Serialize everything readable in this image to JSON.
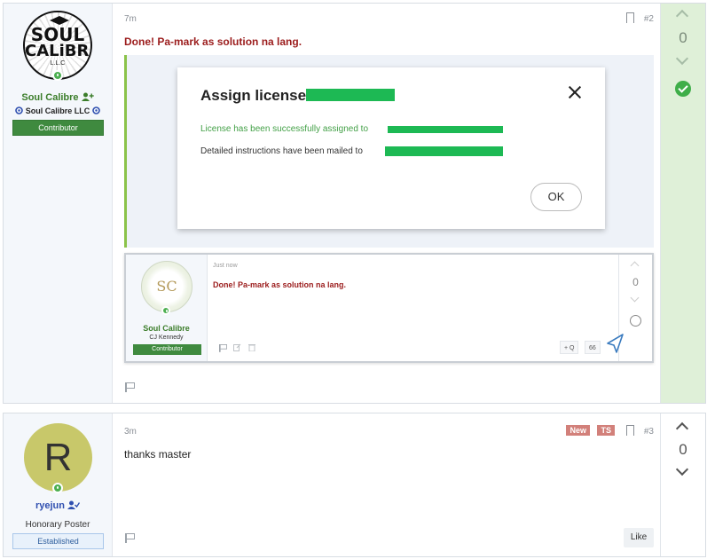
{
  "posts": [
    {
      "username": "Soul Calibre",
      "user_title": "Soul Calibre LLC",
      "banner": "Contributor",
      "time": "7m",
      "number": "#2",
      "message": "Done! Pa-mark as solution na lang.",
      "votes": "0",
      "solution": true,
      "avatar_text": {
        "line1": "SOUL",
        "line2": "CALiBRE",
        "line3": "L.L.C"
      },
      "screenshot_dialog": {
        "title": "Assign license:",
        "line1": "License has been successfully assigned to",
        "line2": "Detailed instructions have been mailed to",
        "ok": "OK"
      },
      "embedded_post": {
        "time": "Just now",
        "message": "Done! Pa-mark as solution na lang.",
        "username": "Soul Calibre",
        "user_sub": "CJ Kennedy",
        "banner": "Contributor",
        "votes": "0",
        "avatar_monogram": "SC",
        "quote_btn": "+ Q",
        "reply_btn": "66"
      }
    },
    {
      "username": "ryejun",
      "user_title": "Honorary Poster",
      "banner": "Established",
      "avatar_letter": "R",
      "time": "3m",
      "number": "#3",
      "badge_new": "New",
      "badge_ts": "TS",
      "message": "thanks master",
      "votes": "0",
      "like": "Like"
    }
  ],
  "colors": {
    "username_green": "#3b7d2a",
    "username_blue": "#2f4fb0",
    "contributor_banner": "#3f8a3f",
    "solution_bg": "#dff0d8",
    "redaction": "#1db954",
    "message_red": "#9b1c1c"
  }
}
